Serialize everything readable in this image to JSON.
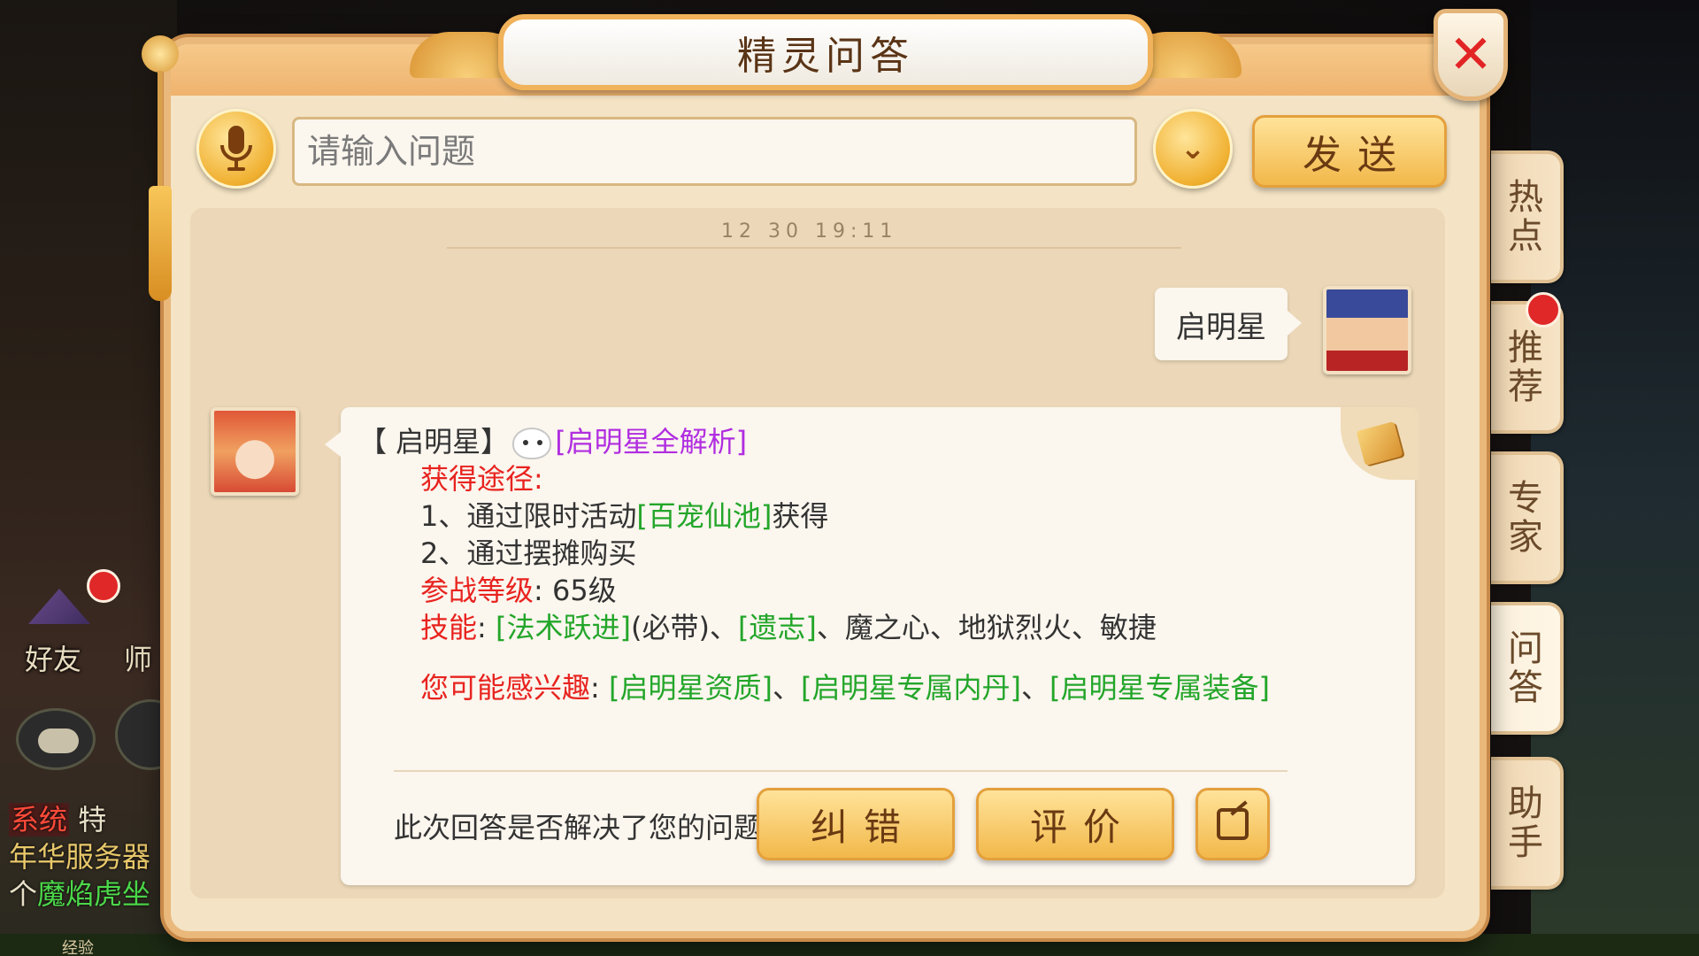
{
  "dialog": {
    "title": "精灵问答",
    "close_label": "✕"
  },
  "input": {
    "placeholder": "请输入问题",
    "value": "",
    "dropdown_label": "⌄",
    "send_label": "发送"
  },
  "chat": {
    "timestamp": "12 30 19:11",
    "user_message": "启明星",
    "answer": {
      "title_bracket": "【 启明星】",
      "title_link": "[启明星全解析]",
      "obtain_label": "获得途径:",
      "obtain_1_prefix": "1、通过限时活动",
      "obtain_1_link": "[百宠仙池]",
      "obtain_1_suffix": "获得",
      "obtain_2": "2、通过摆摊购买",
      "level_label": "参战等级",
      "level_value": ": 65级",
      "skills_label": "技能",
      "skills_colon": ": ",
      "skill_link_1": "[法术跃进]",
      "skill_note_1": "(必带)、",
      "skill_link_2": "[遗志]",
      "skill_rest": "、魔之心、地狱烈火、敏捷",
      "interest_label": "您可能感兴趣",
      "interest_colon": ": ",
      "interest_link_1": "[启明星资质]",
      "interest_sep_1": "、",
      "interest_link_2": "[启明星专属内丹]",
      "interest_sep_2": "、",
      "interest_link_3": "[启明星专属装备]"
    },
    "feedback_question": "此次回答是否解决了您的问题?",
    "correct_label": "纠错",
    "rate_label": "评价"
  },
  "side_tabs": [
    {
      "label_1": "热",
      "label_2": "点"
    },
    {
      "label_1": "推",
      "label_2": "荐"
    },
    {
      "label_1": "专",
      "label_2": "家"
    },
    {
      "label_1": "问",
      "label_2": "答"
    },
    {
      "label_1": "助",
      "label_2": "手"
    }
  ],
  "game_hud": {
    "friend_label": "好友",
    "master_label": "师",
    "chat_log": {
      "tag": "系统",
      "line1_rest": " 特",
      "line2": "年华服务器",
      "line3_prefix": "个",
      "line3_name": "魔焰虎坐"
    },
    "exp_label": "经验"
  },
  "colors": {
    "accent_gold": "#f2b84a",
    "link_green": "#23a62a",
    "label_red": "#e8231f",
    "link_purple": "#b02ee0",
    "close_red": "#e22424"
  }
}
